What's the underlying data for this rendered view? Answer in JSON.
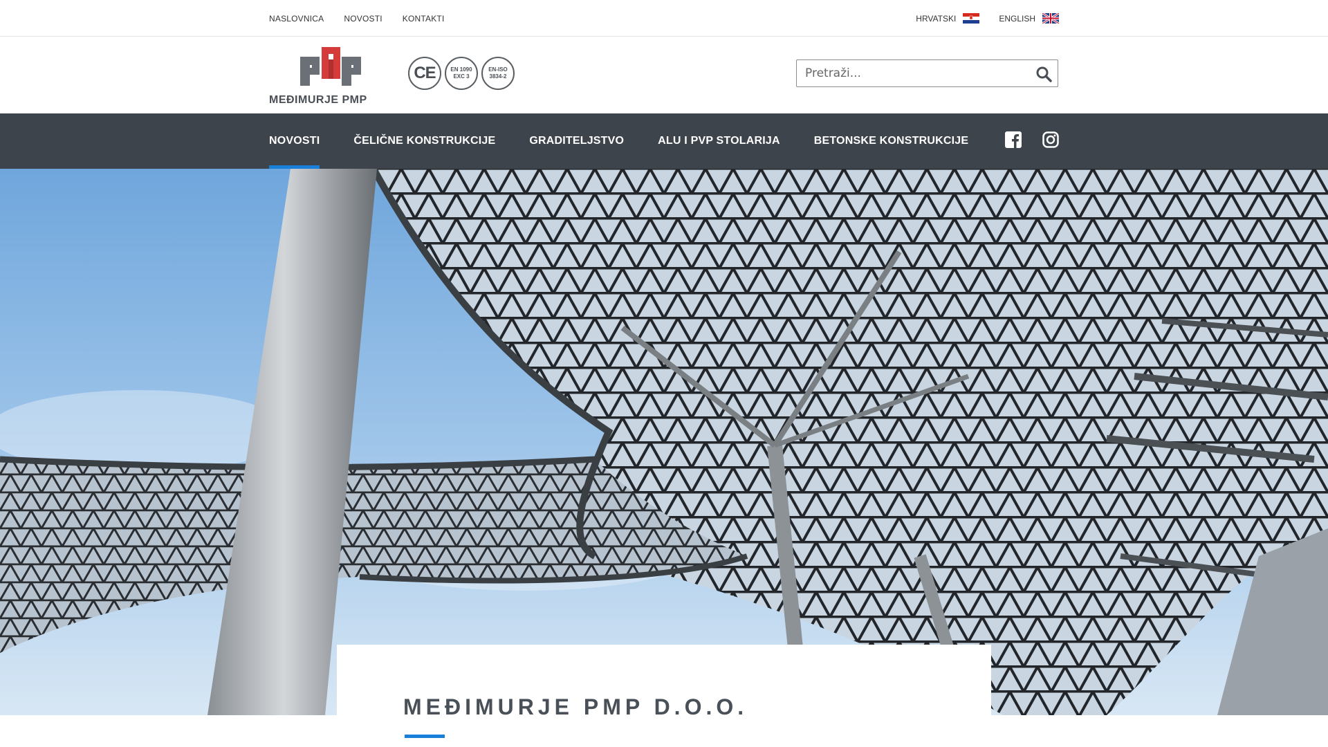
{
  "topnav": {
    "items": [
      "NASLOVNICA",
      "NOVOSTI",
      "KONTAKTI"
    ]
  },
  "languages": [
    {
      "label": "HRVATSKI",
      "flag": "croatia-flag-icon"
    },
    {
      "label": "ENGLISH",
      "flag": "uk-flag-icon"
    }
  ],
  "logo": {
    "text": "MEĐIMURJE PMP",
    "brand_colors": {
      "red": "#d63b3b",
      "grey": "#5a5f64"
    }
  },
  "certifications": [
    {
      "line1": "CE",
      "line2": ""
    },
    {
      "line1": "EN 1090",
      "line2": "EXC 3"
    },
    {
      "line1": "EN-ISO",
      "line2": "3834-2"
    }
  ],
  "search": {
    "placeholder": "Pretraži...",
    "icon": "search-icon"
  },
  "mainnav": {
    "items": [
      "NOVOSTI",
      "ČELIČNE KONSTRUKCIJE",
      "GRADITELJSTVO",
      "ALU I PVP STOLARIJA",
      "BETONSKE KONSTRUKCIJE"
    ],
    "active": "NOVOSTI",
    "background": "#3e444b",
    "accent": "#1a7fd8"
  },
  "social": [
    "facebook-icon",
    "instagram-icon"
  ],
  "card": {
    "title": "MEĐIMURJE PMP D.O.O."
  }
}
